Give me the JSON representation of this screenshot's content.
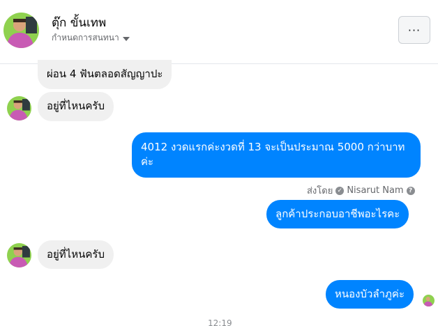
{
  "header": {
    "contact_name": "ตุ๊ก ขั้นเทพ",
    "subtitle": "กำหนดการสนทนา",
    "more_label": "···"
  },
  "messages": [
    {
      "side": "incoming",
      "text": "ผ่อน 4 ฟันตลอดสัญญาปะ"
    },
    {
      "side": "incoming",
      "text": "อยู่ที่ไหนครับ"
    },
    {
      "side": "outgoing",
      "text": "4012 งวดแรกค่ะงวดที่ 13 จะเป็นประมาณ 5000 กว่าบาทค่ะ"
    },
    {
      "side": "outgoing",
      "text": "ลูกค้าประกอบอาชีพอะไรคะ"
    },
    {
      "side": "incoming",
      "text": "อยู่ที่ไหนครับ"
    },
    {
      "side": "outgoing",
      "text": "หนองบัวลำภูค่ะ"
    }
  ],
  "sent_by": {
    "prefix": "ส่งโดย",
    "name": "Nisarut Nam",
    "help_glyph": "?"
  },
  "timestamp": "12:19",
  "colors": {
    "outgoing_bubble": "#0084ff",
    "incoming_bubble": "#f0f0f0",
    "divider": "#e4e6eb"
  },
  "icons": {
    "more": "more-options-icon",
    "dropdown": "caret-down-icon",
    "verified": "check-circle-icon",
    "help": "help-circle-icon"
  }
}
